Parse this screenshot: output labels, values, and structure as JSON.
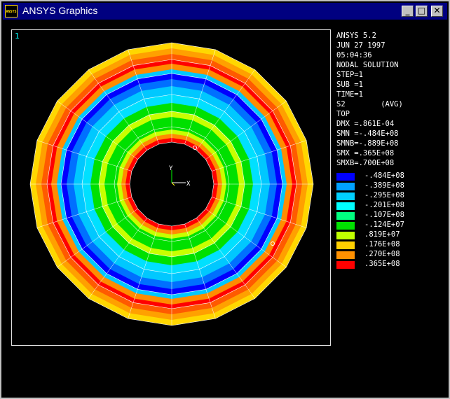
{
  "window": {
    "title": "ANSYS Graphics",
    "icon_name": "ansys-app-icon",
    "icon_text": "ANSYS"
  },
  "controls": {
    "minimize": "_",
    "maximize": "□",
    "close": "✕"
  },
  "plot": {
    "window_number": "1",
    "axis_y": "Y",
    "axis_x": "X",
    "band_colors": [
      "#ff0000",
      "#ff8c00",
      "#ffd700",
      "#c8ff00",
      "#00e000",
      "#00c8ff",
      "#0096ff",
      "#0000ff"
    ]
  },
  "info": {
    "lines": [
      "ANSYS 5.2",
      "JUN 27 1997",
      "05:04:36",
      "NODAL SOLUTION",
      "STEP=1",
      "SUB =1",
      "TIME=1",
      "S2        (AVG)",
      "TOP",
      "DMX =.861E-04",
      "SMN =-.484E+08",
      "SMNB=-.889E+08",
      "SMX =.365E+08",
      "SMXB=.700E+08"
    ]
  },
  "legend": [
    {
      "label": "-.484E+08",
      "color": "#0000ff"
    },
    {
      "label": "-.389E+08",
      "color": "#00a0ff"
    },
    {
      "label": "-.295E+08",
      "color": "#00d0ff"
    },
    {
      "label": "-.201E+08",
      "color": "#00ffff"
    },
    {
      "label": "-.107E+08",
      "color": "#00ff80"
    },
    {
      "label": "-.124E+07",
      "color": "#00e000"
    },
    {
      "label": ".819E+07",
      "color": "#c0ff00"
    },
    {
      "label": ".176E+08",
      "color": "#ffd000"
    },
    {
      "label": ".270E+08",
      "color": "#ff9000"
    },
    {
      "label": ".365E+08",
      "color": "#ff0000"
    }
  ]
}
